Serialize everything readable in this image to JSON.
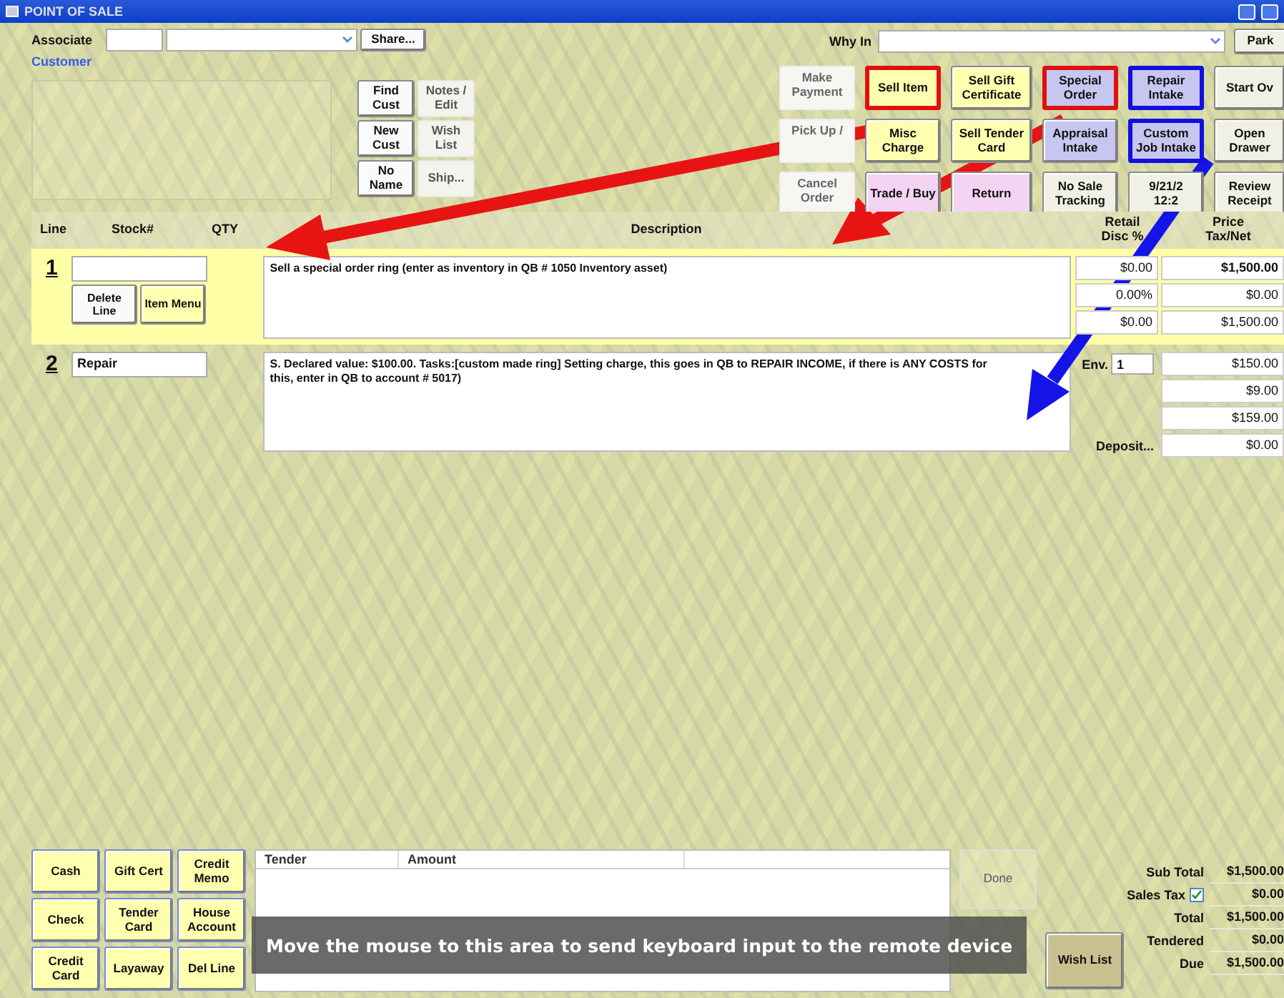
{
  "window": {
    "title": "POINT OF SALE"
  },
  "header": {
    "associate_label": "Associate",
    "share_button": "Share...",
    "customer_label": "Customer",
    "why_in_label": "Why In",
    "park_button": "Park",
    "customer_buttons": [
      {
        "label": "Find\nCust",
        "kind": "raised"
      },
      {
        "label": "Notes /\nEdit",
        "kind": "flat"
      },
      {
        "label": "New\nCust",
        "kind": "raised"
      },
      {
        "label": "Wish\nList",
        "kind": "flat"
      },
      {
        "label": "No\nName",
        "kind": "raised"
      },
      {
        "label": "Ship...",
        "kind": "flat"
      }
    ]
  },
  "action_buttons": [
    {
      "label": "Make\nPayment",
      "kind": "plain"
    },
    {
      "label": "Sell Item",
      "kind": "sale",
      "color": "#e01010"
    },
    {
      "label": "Sell Gift\nCertificate",
      "kind": "sale"
    },
    {
      "label": "Special\nOrder",
      "kind": "intake",
      "color": "#e01010"
    },
    {
      "label": "Repair\nIntake",
      "kind": "intake",
      "color": "#1010e0"
    },
    {
      "label": "Start Ov",
      "kind": "utility"
    },
    {
      "label": "Pick Up /",
      "kind": "plain"
    },
    {
      "label": "Misc\nCharge",
      "kind": "sale"
    },
    {
      "label": "Sell Tender\nCard",
      "kind": "sale"
    },
    {
      "label": "Appraisal\nIntake",
      "kind": "intake"
    },
    {
      "label": "Custom\nJob Intake",
      "kind": "intake",
      "color": "#1010e0"
    },
    {
      "label": "Open\nDrawer",
      "kind": "utility"
    },
    {
      "label": "Cancel\nOrder",
      "kind": "plain"
    },
    {
      "label": "Trade / Buy",
      "kind": "trade"
    },
    {
      "label": "Return",
      "kind": "trade"
    },
    {
      "label": "No Sale\nTracking",
      "kind": "utility"
    },
    {
      "label": "9/21/2\n12:2",
      "kind": "utility"
    },
    {
      "label": "Review\nReceipt",
      "kind": "utility"
    }
  ],
  "columns": [
    "Line",
    "Stock#",
    "QTY",
    "Description",
    "Retail\nDisc %",
    "Price\nTax/Net"
  ],
  "lines": [
    {
      "number": "1",
      "selected": true,
      "line_buttons": [
        "Delete\nLine",
        "Item Menu"
      ],
      "description": "Sell a special order ring  (enter as inventory in QB # 1050 Inventory asset)",
      "retail": [
        "$0.00",
        "0.00%",
        "$0.00"
      ],
      "price": [
        "$1,500.00",
        "$0.00",
        "$1,500.00"
      ]
    },
    {
      "number": "2",
      "selected": false,
      "stock": "Repair",
      "description": "S. Declared value: $100.00. Tasks:[custom made ring] Setting charge, this goes in QB to REPAIR INCOME, if there is ANY COSTS for this, enter in QB to account # 5017)",
      "env_label": "Env.",
      "env_value": "1",
      "deposit_label": "Deposit...",
      "price": [
        "$150.00",
        "$9.00",
        "$159.00",
        "$0.00"
      ]
    }
  ],
  "payment_buttons": [
    "Cash",
    "Gift Cert",
    "Credit\nMemo",
    "Check",
    "Tender\nCard",
    "House\nAccount",
    "Credit\nCard",
    "Layaway",
    "Del Line"
  ],
  "tender_table": {
    "columns": [
      "Tender",
      "Amount"
    ]
  },
  "done_button": "Done",
  "wish_list_button": "Wish List",
  "totals": [
    {
      "label": "Sub Total",
      "value": "$1,500.00"
    },
    {
      "label": "Sales Tax",
      "value": "$0.00",
      "checked": true
    },
    {
      "label": "Total",
      "value": "$1,500.00"
    },
    {
      "label": "Tendered",
      "value": "$0.00"
    },
    {
      "label": "Due",
      "value": "$1,500.00"
    }
  ],
  "remote_banner": "Move the mouse to this area to send keyboard input to the remote device"
}
